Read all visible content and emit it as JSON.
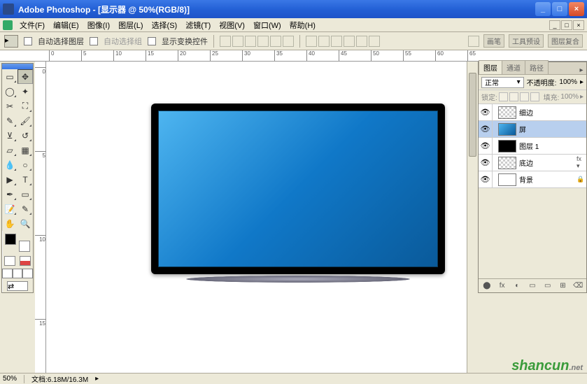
{
  "title_bar": {
    "title": "Adobe Photoshop - [显示器 @ 50%(RGB/8)]",
    "min": "_",
    "max": "□",
    "close": "×"
  },
  "menu": {
    "items": [
      "文件(F)",
      "编辑(E)",
      "图像(I)",
      "图层(L)",
      "选择(S)",
      "滤镜(T)",
      "视图(V)",
      "窗口(W)",
      "帮助(H)"
    ],
    "mdi": [
      "_",
      "□",
      "×"
    ]
  },
  "options": {
    "auto_select_layer": "自动选择图层",
    "auto_select_group": "自动选择组",
    "show_transform": "显示变换控件",
    "dock_tabs": [
      "画笔",
      "工具预设",
      "图层复合"
    ]
  },
  "ruler_h": [
    0,
    5,
    10,
    15,
    20,
    25,
    30,
    35,
    40,
    45,
    50,
    55,
    60,
    65
  ],
  "ruler_v": [
    0,
    5,
    10,
    15
  ],
  "panel": {
    "tabs": [
      "图层",
      "通道",
      "路径"
    ],
    "blend_mode": "正常",
    "opacity_label": "不透明度:",
    "opacity_value": "100%",
    "lock_label": "锁定:",
    "fill_label": "填充:",
    "fill_value": "100%",
    "layers": [
      {
        "name": "细边",
        "thumb": "checker"
      },
      {
        "name": "屏",
        "thumb": "screen"
      },
      {
        "name": "图层 1",
        "thumb": "black"
      },
      {
        "name": "底边",
        "thumb": "checker",
        "fx": true
      },
      {
        "name": "背景",
        "thumb": "white",
        "locked": true
      }
    ],
    "bottom_icons": [
      "⬤",
      "fx",
      "◐",
      "▭",
      "⊞",
      "⌫"
    ]
  },
  "status": {
    "zoom": "50%",
    "doc_info": "文档:6.18M/16.3M"
  },
  "watermark": {
    "main": "shancun",
    "sub": ".net"
  }
}
